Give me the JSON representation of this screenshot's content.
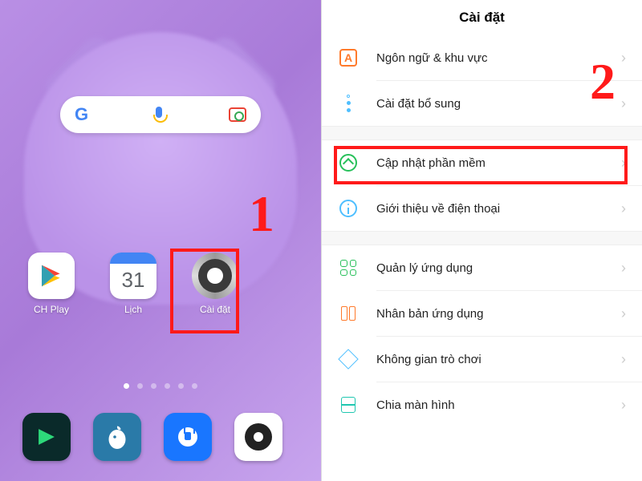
{
  "left": {
    "search_google": "Google",
    "apps": [
      {
        "label": "CH Play"
      },
      {
        "label": "Lịch",
        "cal_day": "31"
      },
      {
        "label": "Cài đặt"
      }
    ],
    "step1": "1"
  },
  "right": {
    "title": "Cài đặt",
    "step2": "2",
    "rows": [
      {
        "label": "Ngôn ngữ & khu vực",
        "badge": "A"
      },
      {
        "label": "Cài đặt bổ sung"
      },
      {
        "label": "Cập nhật phần mềm"
      },
      {
        "label": "Giới thiệu về điện thoại"
      },
      {
        "label": "Quản lý ứng dụng"
      },
      {
        "label": "Nhân bản ứng dụng"
      },
      {
        "label": "Không gian trò chơi"
      },
      {
        "label": "Chia màn hình"
      }
    ]
  }
}
